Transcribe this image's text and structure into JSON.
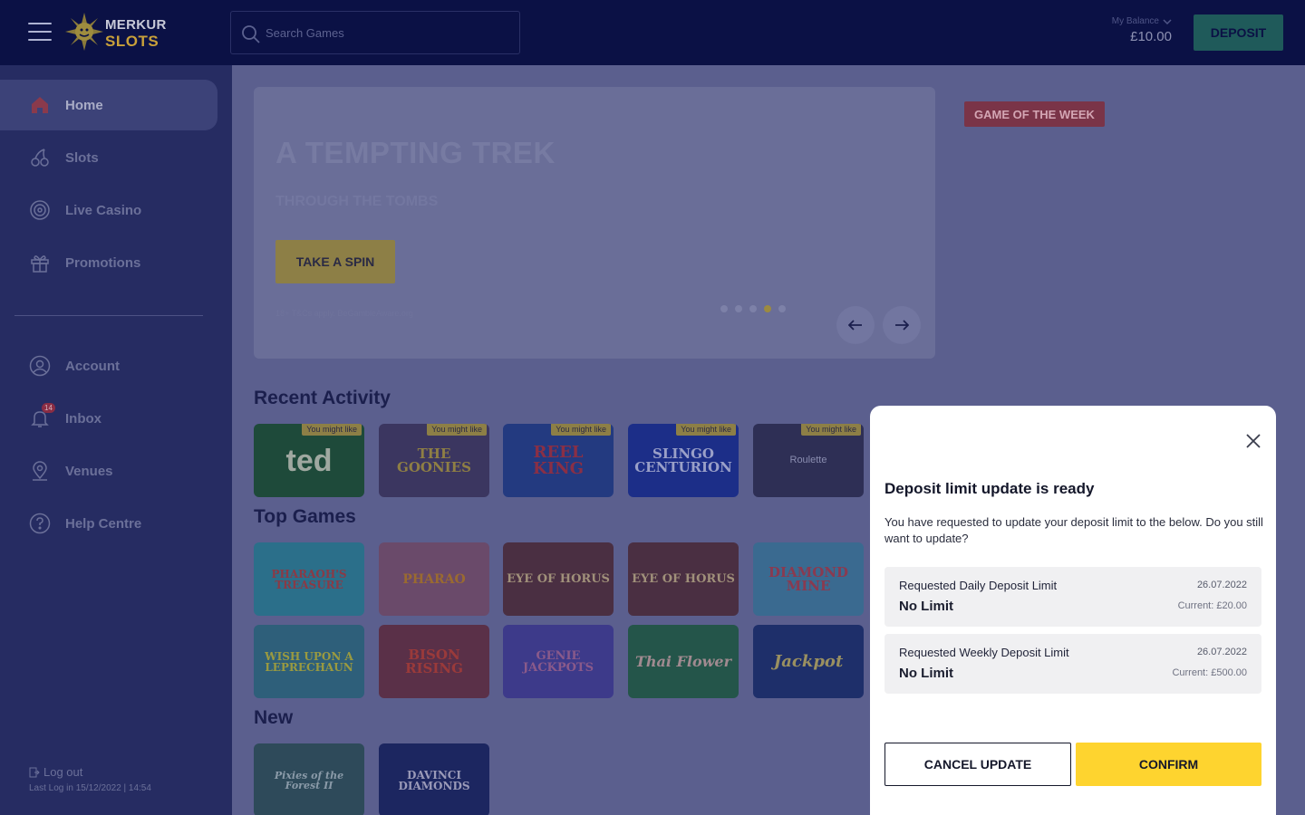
{
  "header": {
    "logo_line1": "MERKUR",
    "logo_line2": "SLOTS",
    "search_placeholder": "Search Games",
    "balance_label": "My Balance",
    "balance_value": "£10.00",
    "deposit_label": "DEPOSIT"
  },
  "sidebar": {
    "items": [
      {
        "label": "Home",
        "icon": "home-icon"
      },
      {
        "label": "Slots",
        "icon": "cherry-icon"
      },
      {
        "label": "Live Casino",
        "icon": "roulette-icon"
      },
      {
        "label": "Promotions",
        "icon": "gift-icon"
      }
    ],
    "account_items": [
      {
        "label": "Account",
        "icon": "user-icon"
      },
      {
        "label": "Inbox",
        "icon": "bell-icon",
        "badge": "14"
      },
      {
        "label": "Venues",
        "icon": "map-pin-icon"
      },
      {
        "label": "Help Centre",
        "icon": "help-icon"
      }
    ],
    "logout_label": "Log out",
    "last_login": "Last Log in 15/12/2022 | 14:54"
  },
  "hero": {
    "title": "A TEMPTING TREK",
    "subtitle": "THROUGH THE TOMBS",
    "button_label": "TAKE A SPIN",
    "terms": "18+ T&Cs apply. BeGambleAware.org",
    "slides_total": 5,
    "slide_active": 4,
    "game_of_week_label": "GAME OF THE WEEK"
  },
  "sections": {
    "recent_title": "Recent Activity",
    "top_title": "Top Games",
    "new_title": "New",
    "tag_label": "You might like",
    "recent": [
      {
        "name": "ted"
      },
      {
        "name": "THE GOONIES"
      },
      {
        "name": "REEL KING"
      },
      {
        "name": "SLINGO CENTURION"
      },
      {
        "name": "Roulette"
      }
    ],
    "top": [
      {
        "name": "PHARAOH'S TREASURE"
      },
      {
        "name": "PHARAO"
      },
      {
        "name": "EYE OF HORUS"
      },
      {
        "name": "EYE OF HORUS"
      },
      {
        "name": "DIAMOND MINE"
      },
      {
        "name": "WISH UPON A LEPRECHAUN"
      },
      {
        "name": "BISON RISING"
      },
      {
        "name": "GENIE JACKPOTS"
      },
      {
        "name": "Thai Flower"
      },
      {
        "name": "Jackpot"
      }
    ],
    "new": [
      {
        "name": "Pixies of the Forest II"
      },
      {
        "name": "DAVINCI DIAMONDS"
      }
    ]
  },
  "modal": {
    "title": "Deposit limit update is ready",
    "text": "You have requested to update your deposit limit to the below. Do you still want to update?",
    "limits": [
      {
        "label": "Requested Daily Deposit Limit",
        "date": "26.07.2022",
        "value": "No Limit",
        "current": "Current: £20.00"
      },
      {
        "label": "Requested Weekly Deposit Limit",
        "date": "26.07.2022",
        "value": "No Limit",
        "current": "Current: £500.00"
      }
    ],
    "cancel_label": "CANCEL UPDATE",
    "confirm_label": "CONFIRM"
  },
  "colors": {
    "header_bg": "#0b1145",
    "sidebar_bg": "#262c62",
    "overlay_bg": "#5b5f8e",
    "deposit_green": "#1f5a5a",
    "confirm_yellow": "#fed42f",
    "gotw_red": "#7a3448"
  }
}
